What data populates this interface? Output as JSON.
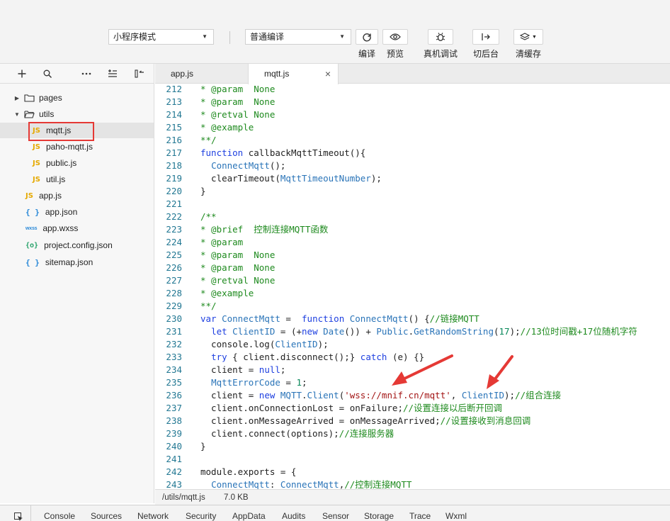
{
  "toolbar": {
    "mode_select": "小程序模式",
    "compile_select": "普通编译",
    "buttons": [
      {
        "icon": "refresh-icon",
        "label": "编译"
      },
      {
        "icon": "eye-icon",
        "label": "预览"
      },
      {
        "icon": "bug-icon",
        "label": "真机调试"
      },
      {
        "icon": "switch-backend-icon",
        "label": "切后台"
      },
      {
        "icon": "layers-icon",
        "label": "清缓存"
      }
    ]
  },
  "sidebar": {
    "tools": [
      "add-icon",
      "search-icon",
      "more-icon",
      "outline-icon",
      "collapse-panel-icon"
    ],
    "tree": [
      {
        "type": "folder",
        "label": "pages",
        "expanded": false,
        "indent": 0
      },
      {
        "type": "folder",
        "label": "utils",
        "expanded": true,
        "indent": 0
      },
      {
        "type": "js",
        "label": "mqtt.js",
        "indent": 1,
        "selected": true
      },
      {
        "type": "js",
        "label": "paho-mqtt.js",
        "indent": 1
      },
      {
        "type": "js",
        "label": "public.js",
        "indent": 1
      },
      {
        "type": "js",
        "label": "util.js",
        "indent": 1
      },
      {
        "type": "js",
        "label": "app.js",
        "indent": 0
      },
      {
        "type": "json",
        "label": "app.json",
        "indent": 0
      },
      {
        "type": "wxss",
        "label": "app.wxss",
        "indent": 0
      },
      {
        "type": "cfg",
        "label": "project.config.json",
        "indent": 0
      },
      {
        "type": "json",
        "label": "sitemap.json",
        "indent": 0
      }
    ],
    "icon_glyphs": {
      "js": "JS",
      "json": "{ }",
      "wxss": "wxss",
      "cfg": "{o}"
    }
  },
  "editor": {
    "tabs": [
      {
        "label": "app.js",
        "active": false
      },
      {
        "label": "mqtt.js",
        "active": true,
        "close": "×"
      }
    ],
    "lines": [
      {
        "n": "212",
        "tokens": [
          [
            "c",
            "* @param  None"
          ]
        ]
      },
      {
        "n": "213",
        "tokens": [
          [
            "c",
            "* @param  None"
          ]
        ]
      },
      {
        "n": "214",
        "tokens": [
          [
            "c",
            "* @retval None"
          ]
        ]
      },
      {
        "n": "215",
        "tokens": [
          [
            "c",
            "* @example"
          ]
        ]
      },
      {
        "n": "216",
        "tokens": [
          [
            "c",
            "**/"
          ]
        ]
      },
      {
        "n": "217",
        "tokens": [
          [
            "k",
            "function "
          ],
          [
            "f",
            "callbackMqttTimeout(){"
          ]
        ]
      },
      {
        "n": "218",
        "tokens": [
          [
            "p",
            "  "
          ],
          [
            "v",
            "ConnectMqtt"
          ],
          [
            "p",
            "();"
          ]
        ]
      },
      {
        "n": "219",
        "tokens": [
          [
            "p",
            "  clearTimeout("
          ],
          [
            "v",
            "MqttTimeoutNumber"
          ],
          [
            "p",
            ");"
          ]
        ]
      },
      {
        "n": "220",
        "tokens": [
          [
            "p",
            "}"
          ]
        ]
      },
      {
        "n": "221",
        "tokens": []
      },
      {
        "n": "222",
        "tokens": [
          [
            "c",
            "/**"
          ]
        ]
      },
      {
        "n": "223",
        "tokens": [
          [
            "c",
            "* @brief  控制连接MQTT函数"
          ]
        ]
      },
      {
        "n": "224",
        "tokens": [
          [
            "c",
            "* @param"
          ]
        ]
      },
      {
        "n": "225",
        "tokens": [
          [
            "c",
            "* @param  None"
          ]
        ]
      },
      {
        "n": "226",
        "tokens": [
          [
            "c",
            "* @param  None"
          ]
        ]
      },
      {
        "n": "227",
        "tokens": [
          [
            "c",
            "* @retval None"
          ]
        ]
      },
      {
        "n": "228",
        "tokens": [
          [
            "c",
            "* @example"
          ]
        ]
      },
      {
        "n": "229",
        "tokens": [
          [
            "c",
            "**/"
          ]
        ]
      },
      {
        "n": "230",
        "tokens": [
          [
            "k",
            "var "
          ],
          [
            "v",
            "ConnectMqtt"
          ],
          [
            "p",
            " =  "
          ],
          [
            "k",
            "function "
          ],
          [
            "v",
            "ConnectMqtt"
          ],
          [
            "p",
            "() {"
          ],
          [
            "c",
            "//链接MQTT"
          ]
        ]
      },
      {
        "n": "231",
        "tokens": [
          [
            "p",
            "  "
          ],
          [
            "k",
            "let "
          ],
          [
            "v",
            "ClientID"
          ],
          [
            "p",
            " = (+"
          ],
          [
            "k",
            "new "
          ],
          [
            "v",
            "Date"
          ],
          [
            "p",
            "()) + "
          ],
          [
            "v",
            "Public"
          ],
          [
            "p",
            "."
          ],
          [
            "v",
            "GetRandomString"
          ],
          [
            "p",
            "("
          ],
          [
            "n",
            "17"
          ],
          [
            "p",
            ");"
          ],
          [
            "c",
            "//13位时间戳+17位随机字符"
          ]
        ]
      },
      {
        "n": "232",
        "tokens": [
          [
            "p",
            "  console.log("
          ],
          [
            "v",
            "ClientID"
          ],
          [
            "p",
            ");"
          ]
        ]
      },
      {
        "n": "233",
        "tokens": [
          [
            "p",
            "  "
          ],
          [
            "k",
            "try"
          ],
          [
            "p",
            " { client.disconnect();} "
          ],
          [
            "k",
            "catch"
          ],
          [
            "p",
            " (e) {}"
          ]
        ]
      },
      {
        "n": "234",
        "tokens": [
          [
            "p",
            "  client = "
          ],
          [
            "k",
            "null"
          ],
          [
            "p",
            ";"
          ]
        ]
      },
      {
        "n": "235",
        "tokens": [
          [
            "p",
            "  "
          ],
          [
            "v",
            "MqttErrorCode"
          ],
          [
            "p",
            " = "
          ],
          [
            "n",
            "1"
          ],
          [
            "p",
            ";"
          ]
        ]
      },
      {
        "n": "236",
        "tokens": [
          [
            "p",
            "  client = "
          ],
          [
            "k",
            "new "
          ],
          [
            "v",
            "MQTT"
          ],
          [
            "p",
            "."
          ],
          [
            "v",
            "Client"
          ],
          [
            "p",
            "("
          ],
          [
            "s",
            "'wss://mnif.cn/mqtt'"
          ],
          [
            "p",
            ", "
          ],
          [
            "v",
            "ClientID"
          ],
          [
            "p",
            ");"
          ],
          [
            "c",
            "//组合连接"
          ]
        ]
      },
      {
        "n": "237",
        "tokens": [
          [
            "p",
            "  client.onConnectionLost = onFailure;"
          ],
          [
            "c",
            "//设置连接以后断开回调"
          ]
        ]
      },
      {
        "n": "238",
        "tokens": [
          [
            "p",
            "  client.onMessageArrived = onMessageArrived;"
          ],
          [
            "c",
            "//设置接收到消息回调"
          ]
        ]
      },
      {
        "n": "239",
        "tokens": [
          [
            "p",
            "  client.connect(options);"
          ],
          [
            "c",
            "//连接服务器"
          ]
        ]
      },
      {
        "n": "240",
        "tokens": [
          [
            "p",
            "}"
          ]
        ]
      },
      {
        "n": "241",
        "tokens": []
      },
      {
        "n": "242",
        "tokens": [
          [
            "p",
            "module.exports = {"
          ]
        ]
      },
      {
        "n": "243",
        "tokens": [
          [
            "p",
            "  "
          ],
          [
            "v",
            "ConnectMqtt"
          ],
          [
            "p",
            ": "
          ],
          [
            "v",
            "ConnectMqtt"
          ],
          [
            "p",
            ","
          ],
          [
            "c",
            "//控制连接MQTT"
          ]
        ]
      }
    ]
  },
  "status": {
    "path": "/utils/mqtt.js",
    "size": "7.0 KB"
  },
  "bottom_tabs": [
    "Console",
    "Sources",
    "Network",
    "Security",
    "AppData",
    "Audits",
    "Sensor",
    "Storage",
    "Trace",
    "Wxml"
  ],
  "colors": {
    "highlight": "#e53935",
    "annotation_arrow": "#e53935"
  }
}
